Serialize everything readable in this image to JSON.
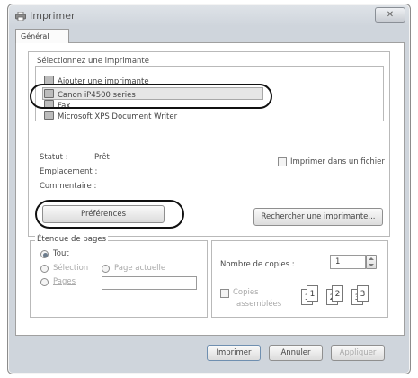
{
  "window": {
    "title": "Imprimer",
    "close_glyph": "✕",
    "tab_label": "Général"
  },
  "printers": {
    "label": "Sélectionnez une imprimante",
    "items": [
      {
        "label": "Ajouter une imprimante",
        "icon": "add-printer-icon"
      },
      {
        "label": "Canon iP4500 series",
        "icon": "printer-icon"
      },
      {
        "label": "Fax",
        "icon": "fax-icon"
      },
      {
        "label": "Microsoft XPS Document Writer",
        "icon": "printer-icon"
      }
    ],
    "selected_index": 1
  },
  "status": {
    "status_label": "Statut :",
    "status_value": "Prêt",
    "location_label": "Emplacement :",
    "comment_label": "Commentaire :",
    "print_to_file_label": "Imprimer dans un fichier",
    "preferences_button": "Préférences",
    "find_printer_button": "Rechercher une imprimante..."
  },
  "page_range": {
    "legend": "Étendue de pages",
    "all_label": "Tout",
    "selection_label": "Sélection",
    "current_page_label": "Page actuelle",
    "pages_label": "Pages",
    "pages_value": "",
    "selected": "all"
  },
  "copies": {
    "count_label": "Nombre de copies :",
    "count_value": "1",
    "collate_label_1": "Copies",
    "collate_label_2": "assemblées",
    "collate_checked": false,
    "collate_pages": [
      "1",
      "1",
      "2",
      "2",
      "3",
      "3"
    ]
  },
  "footer": {
    "print_button": "Imprimer",
    "cancel_button": "Annuler",
    "apply_button": "Appliquer"
  },
  "colors": {
    "window_frame": "#cfd5dc",
    "highlight_oval": "#111111"
  }
}
